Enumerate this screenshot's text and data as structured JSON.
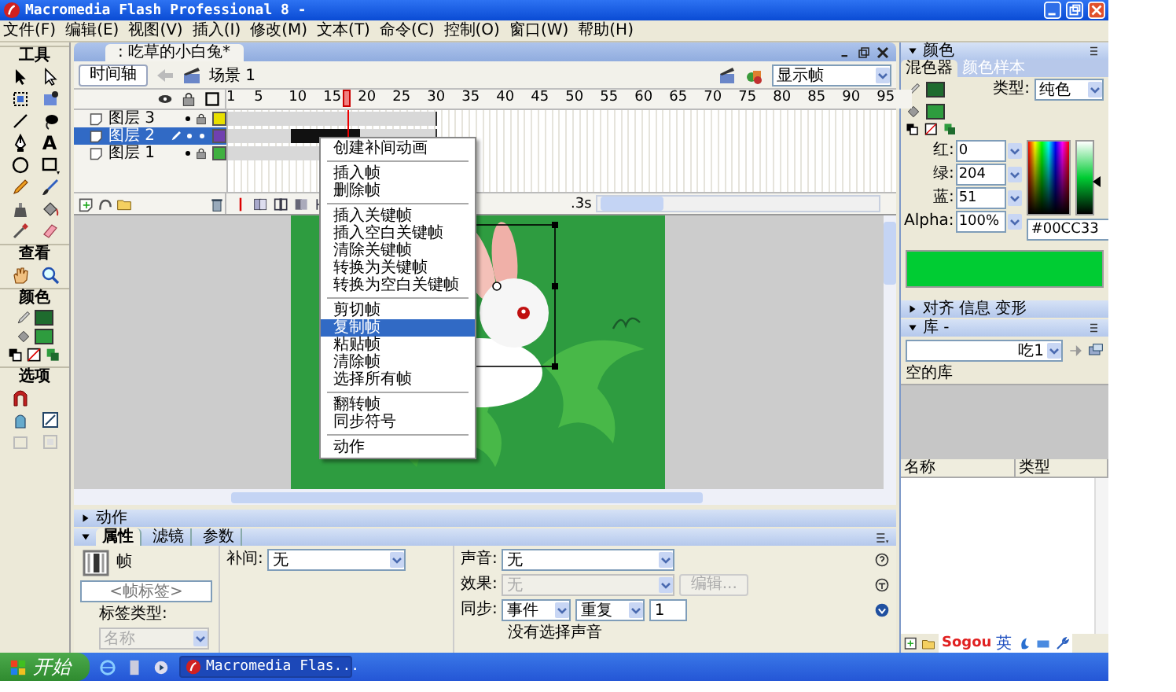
{
  "window": {
    "title": "Macromedia Flash Professional 8 -"
  },
  "menu_bar": [
    "文件(F)",
    "编辑(E)",
    "视图(V)",
    "插入(I)",
    "修改(M)",
    "文本(T)",
    "命令(C)",
    "控制(O)",
    "窗口(W)",
    "帮助(H)"
  ],
  "tools": {
    "title": "工具",
    "text_tool": "A",
    "sections": [
      "查看",
      "颜色",
      "选项"
    ]
  },
  "document": {
    "tab": ": 吃草的小白兔*",
    "timeline_button": "时间轴",
    "scene": "场景 1",
    "view_select": "显示帧"
  },
  "timeline": {
    "frame_numbers": [
      "1",
      "5",
      "10",
      "15",
      "20",
      "25",
      "30",
      "35",
      "40",
      "45",
      "50",
      "55",
      "60",
      "65",
      "70",
      "75",
      "80",
      "85",
      "90",
      "95"
    ],
    "elapsed": ".3s",
    "layers": [
      {
        "name": "图层 3",
        "selected": false,
        "locked": true,
        "color": "#e8e000"
      },
      {
        "name": "图层 2",
        "selected": true,
        "locked": false,
        "color": "#7040b0"
      },
      {
        "name": "图层 1",
        "selected": false,
        "locked": true,
        "color": "#40b040"
      }
    ]
  },
  "context_menu": {
    "groups": [
      [
        {
          "label": "创建补间动画",
          "selected": false
        }
      ],
      [
        {
          "label": "插入帧",
          "selected": false
        },
        {
          "label": "删除帧",
          "selected": false
        }
      ],
      [
        {
          "label": "插入关键帧",
          "selected": false
        },
        {
          "label": "插入空白关键帧",
          "selected": false
        },
        {
          "label": "清除关键帧",
          "selected": false
        },
        {
          "label": "转换为关键帧",
          "selected": false
        },
        {
          "label": "转换为空白关键帧",
          "selected": false
        }
      ],
      [
        {
          "label": "剪切帧",
          "selected": false
        },
        {
          "label": "复制帧",
          "selected": true
        },
        {
          "label": "粘贴帧",
          "selected": false
        },
        {
          "label": "清除帧",
          "selected": false
        },
        {
          "label": "选择所有帧",
          "selected": false
        }
      ],
      [
        {
          "label": "翻转帧",
          "selected": false
        },
        {
          "label": "同步符号",
          "selected": false
        }
      ],
      [
        {
          "label": "动作",
          "selected": false
        }
      ]
    ]
  },
  "actions_panel": {
    "title": "动作",
    "expanded": false
  },
  "properties_panel": {
    "tabs": [
      {
        "label": "属性",
        "selected": true
      },
      {
        "label": "滤镜",
        "selected": false
      },
      {
        "label": "参数",
        "selected": false
      }
    ],
    "frame_title": "帧",
    "frame_label": {
      "placeholder": "<帧标签>"
    },
    "label_type": "标签类型:",
    "label_type_select": {
      "value": "名称",
      "disabled": true
    },
    "tween": {
      "label": "补间:",
      "value": "无"
    },
    "sound": {
      "label": "声音:",
      "value": "无"
    },
    "effect": {
      "label": "效果:",
      "value": "无",
      "disabled": true
    },
    "edit_button": {
      "label": "编辑...",
      "disabled": true
    },
    "sync": {
      "label": "同步:",
      "value": "事件"
    },
    "repeat": "重复",
    "repeat_count": "1",
    "sound_status": "没有选择声音"
  },
  "color_panel": {
    "title": "颜色",
    "tabs": [
      {
        "label": "混色器",
        "selected": true
      },
      {
        "label": "颜色样本",
        "selected": false
      }
    ],
    "type": {
      "label": "类型:",
      "value": "纯色"
    },
    "channels": [
      {
        "label": "红:",
        "value": "0"
      },
      {
        "label": "绿:",
        "value": "204"
      },
      {
        "label": "蓝:",
        "value": "51"
      },
      {
        "label": "Alpha:",
        "value": "100%"
      }
    ],
    "hex": "#00CC33",
    "brightness": {
      "level": 0.45
    }
  },
  "collapsed_panel": {
    "items": [
      "对齐",
      "信息",
      "变形"
    ]
  },
  "library": {
    "title": "库 -",
    "document_select": "吃1",
    "status": "空的库",
    "columns": [
      "名称",
      "类型"
    ]
  },
  "ime_bar": {
    "logo": "Sogou",
    "mode": "英"
  },
  "taskbar": {
    "start": "开始",
    "tasks": [
      "Macromedia Flas..."
    ]
  }
}
